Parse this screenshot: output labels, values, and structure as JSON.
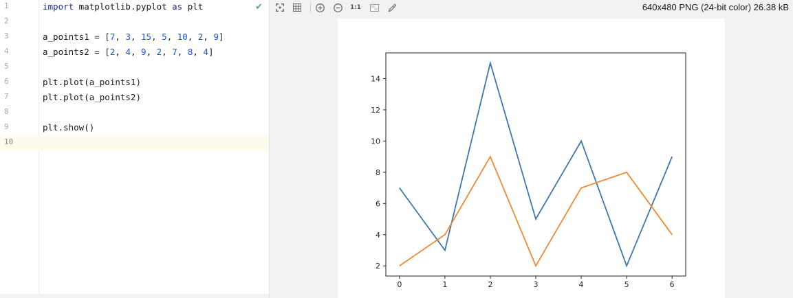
{
  "editor": {
    "lines": [
      {
        "number": "1",
        "tokens": [
          {
            "t": "import",
            "c": "kw"
          },
          {
            "t": " matplotlib.pyplot ",
            "c": ""
          },
          {
            "t": "as",
            "c": "kw"
          },
          {
            "t": " plt",
            "c": ""
          }
        ]
      },
      {
        "number": "2",
        "tokens": []
      },
      {
        "number": "3",
        "tokens": [
          {
            "t": "a_points1 = [",
            "c": ""
          },
          {
            "t": "7",
            "c": "num"
          },
          {
            "t": ", ",
            "c": ""
          },
          {
            "t": "3",
            "c": "num"
          },
          {
            "t": ", ",
            "c": ""
          },
          {
            "t": "15",
            "c": "num"
          },
          {
            "t": ", ",
            "c": ""
          },
          {
            "t": "5",
            "c": "num"
          },
          {
            "t": ", ",
            "c": ""
          },
          {
            "t": "10",
            "c": "num"
          },
          {
            "t": ", ",
            "c": ""
          },
          {
            "t": "2",
            "c": "num"
          },
          {
            "t": ", ",
            "c": ""
          },
          {
            "t": "9",
            "c": "num"
          },
          {
            "t": "]",
            "c": ""
          }
        ]
      },
      {
        "number": "4",
        "tokens": [
          {
            "t": "a_points2 = [",
            "c": ""
          },
          {
            "t": "2",
            "c": "num"
          },
          {
            "t": ", ",
            "c": ""
          },
          {
            "t": "4",
            "c": "num"
          },
          {
            "t": ", ",
            "c": ""
          },
          {
            "t": "9",
            "c": "num"
          },
          {
            "t": ", ",
            "c": ""
          },
          {
            "t": "2",
            "c": "num"
          },
          {
            "t": ", ",
            "c": ""
          },
          {
            "t": "7",
            "c": "num"
          },
          {
            "t": ", ",
            "c": ""
          },
          {
            "t": "8",
            "c": "num"
          },
          {
            "t": ", ",
            "c": ""
          },
          {
            "t": "4",
            "c": "num"
          },
          {
            "t": "]",
            "c": ""
          }
        ]
      },
      {
        "number": "5",
        "tokens": []
      },
      {
        "number": "6",
        "tokens": [
          {
            "t": "plt.plot(a_points1)",
            "c": ""
          }
        ]
      },
      {
        "number": "7",
        "tokens": [
          {
            "t": "plt.plot(a_points2)",
            "c": ""
          }
        ]
      },
      {
        "number": "8",
        "tokens": []
      },
      {
        "number": "9",
        "tokens": [
          {
            "t": "plt.show()",
            "c": ""
          }
        ]
      },
      {
        "number": "10",
        "tokens": []
      }
    ],
    "current_line": 10,
    "status_icon": "checkmark-icon"
  },
  "viewer": {
    "toolbar_icons": [
      "fit-to-screen-icon",
      "grid-icon",
      "zoom-in-icon",
      "zoom-out-icon",
      "actual-size-icon",
      "background-icon",
      "color-picker-icon"
    ],
    "actual_size_label": "1:1",
    "image_info": "640x480 PNG (24-bit color) 26.38 kB"
  },
  "chart_data": {
    "type": "line",
    "x": [
      0,
      1,
      2,
      3,
      4,
      5,
      6
    ],
    "series": [
      {
        "values": [
          7,
          3,
          15,
          5,
          10,
          2,
          9
        ],
        "color": "#3d77b0"
      },
      {
        "values": [
          2,
          4,
          9,
          2,
          7,
          8,
          4
        ],
        "color": "#ee8a31"
      }
    ],
    "xticks": [
      "0",
      "1",
      "2",
      "3",
      "4",
      "5",
      "6"
    ],
    "yticks": [
      "2",
      "4",
      "6",
      "8",
      "10",
      "12",
      "14"
    ],
    "xlim": [
      -0.3,
      6.3
    ],
    "ylim": [
      1.35,
      15.65
    ],
    "title": "",
    "xlabel": "",
    "ylabel": "",
    "grid": false
  }
}
